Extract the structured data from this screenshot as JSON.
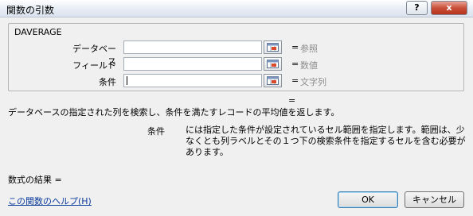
{
  "window": {
    "title": "関数の引数",
    "help_button": "?",
    "close_button": "x"
  },
  "function": {
    "name": "DAVERAGE",
    "arguments": [
      {
        "label": "データベース",
        "value": "",
        "equals": "=",
        "result": "参照"
      },
      {
        "label": "フィールド",
        "value": "",
        "equals": "=",
        "result": "数値"
      },
      {
        "label": "条件",
        "value": "",
        "equals": "=",
        "result": "文字列"
      }
    ],
    "result_equals": "=",
    "description": "データベースの指定された列を検索し、条件を満たすレコードの平均値を返します。",
    "active_argument": {
      "name": "条件",
      "description": "には指定した条件が設定されているセル範囲を指定します。範囲は、少なくとも列ラベルとその１つ下の検索条件を指定するセルを含む必要があります。"
    }
  },
  "footer": {
    "formula_result_label": "数式の結果 =",
    "help_link": "この関数のヘルプ(H)",
    "ok_button": "OK",
    "cancel_button": "キャンセル"
  },
  "colors": {
    "close_button": "#c9503a",
    "link": "#0b3c9c",
    "placeholder_value": "#8d8d8d"
  },
  "icons": {
    "reference": "collapse-dialog-icon"
  }
}
